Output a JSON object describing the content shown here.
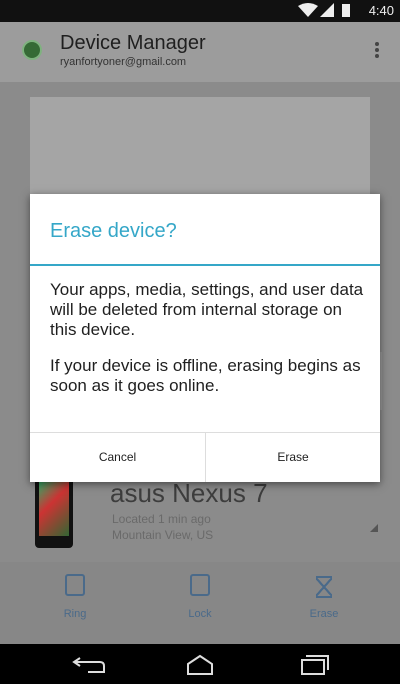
{
  "status_bar": {
    "time": "4:40"
  },
  "app_bar": {
    "title": "Device Manager",
    "account_email": "ryanfortyoner@gmail.com",
    "icons": {
      "logo": "device-manager-logo",
      "overflow": "overflow-menu-icon"
    }
  },
  "device": {
    "name": "asus Nexus 7",
    "last_located": "Located 1 min ago",
    "location": "Mountain View, US"
  },
  "actions": [
    {
      "label": "Ring",
      "icon": "ring-icon"
    },
    {
      "label": "Lock",
      "icon": "lock-icon"
    },
    {
      "label": "Erase",
      "icon": "erase-icon"
    }
  ],
  "dialog": {
    "title": "Erase device?",
    "paragraphs": [
      "Your apps, media, settings, and user data will be deleted from internal storage on this device.",
      "If your device is offline, erasing begins as soon as it goes online."
    ],
    "cancel_label": "Cancel",
    "confirm_label": "Erase"
  },
  "colors": {
    "accent": "#35a7c8",
    "action": "#4a6a8a"
  }
}
